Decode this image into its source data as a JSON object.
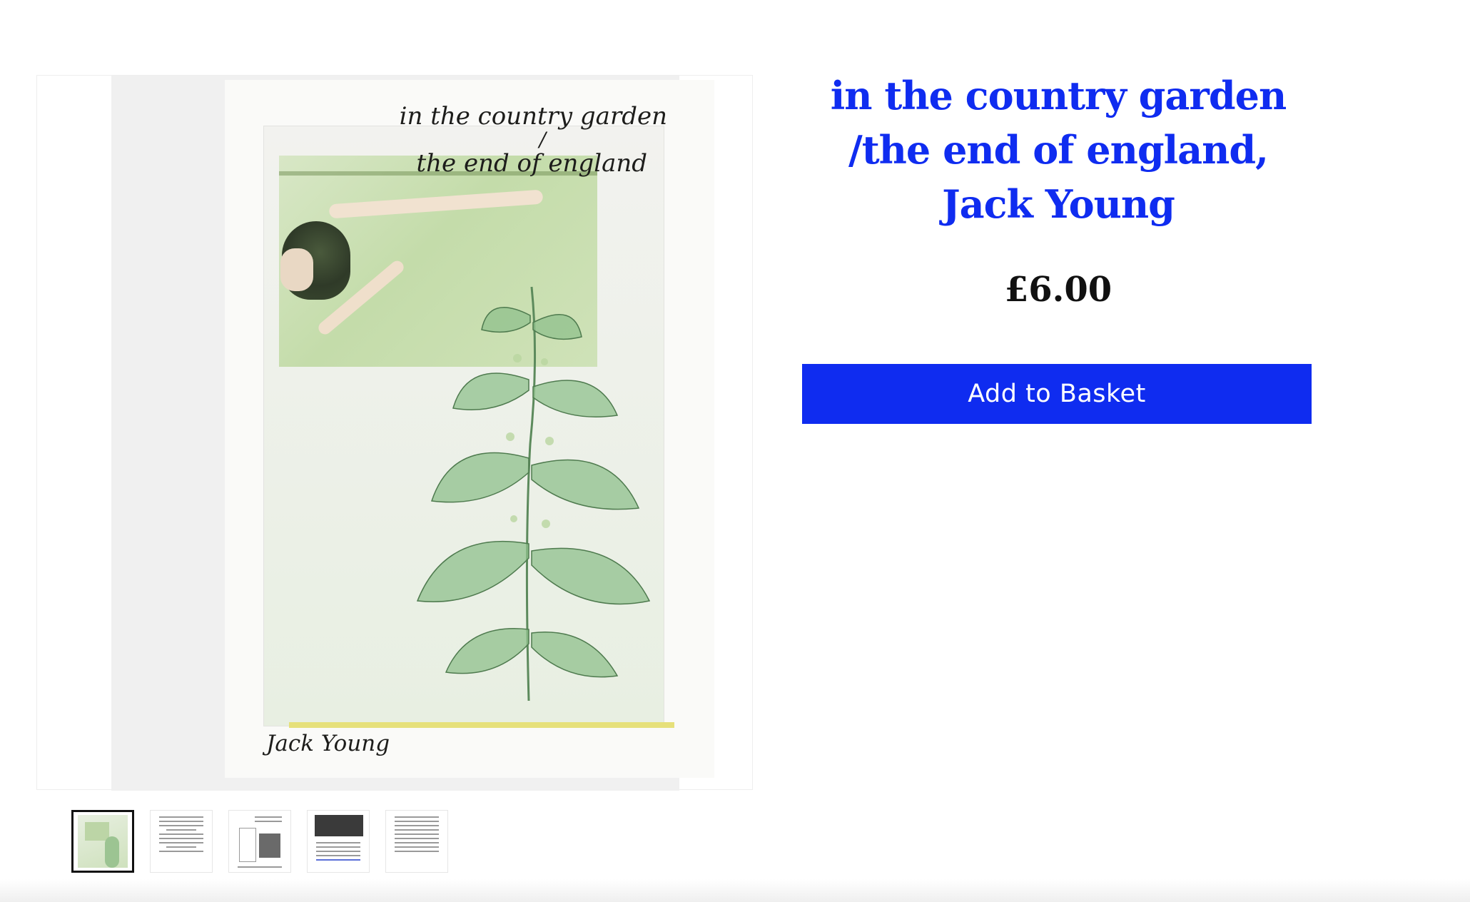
{
  "product": {
    "title": "in the country garden /the end of england, Jack Young",
    "price": "£6.00",
    "add_to_basket_label": "Add to Basket"
  },
  "cover": {
    "title_line1": "in the country garden",
    "title_separator": "/",
    "title_line2": "the end of england",
    "author": "Jack Young"
  },
  "thumbnails": [
    {
      "label": "cover",
      "active": true
    },
    {
      "label": "page text",
      "active": false
    },
    {
      "label": "page layout",
      "active": false
    },
    {
      "label": "page photo",
      "active": false
    },
    {
      "label": "page columns",
      "active": false
    }
  ],
  "colors": {
    "accent": "#0f2cf0",
    "price_text": "#111111",
    "button_text": "#ffffff"
  }
}
